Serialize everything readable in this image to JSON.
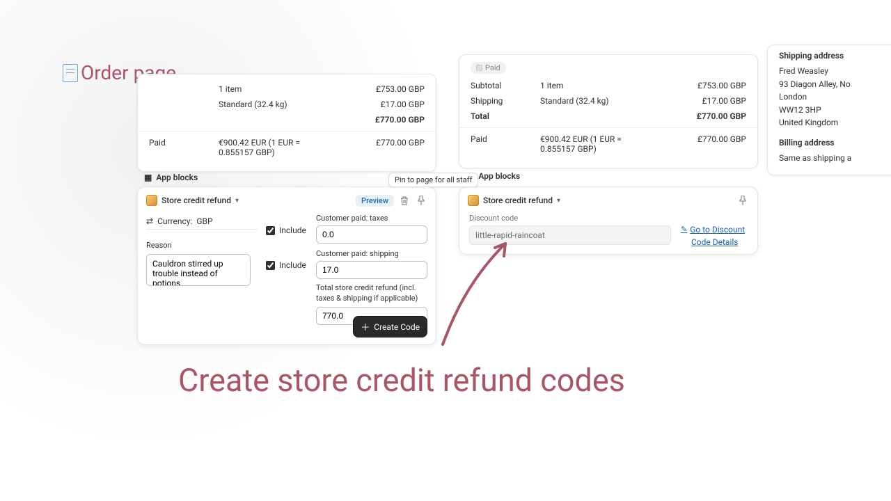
{
  "title": "Order page",
  "caption": "Create store credit refund codes",
  "order_left": {
    "items_label": "1 item",
    "subtotal_price": "£753.00 GBP",
    "shipping_label": "Standard (32.4 kg)",
    "shipping_price": "£17.00 GBP",
    "total_price": "£770.00 GBP",
    "paid_label": "Paid",
    "paid_left_conv": "€900.42 EUR (1 EUR = 0.855157 GBP)",
    "paid_right": "£770.00 GBP"
  },
  "order_right": {
    "paid_badge": "Paid",
    "subtotal_label": "Subtotal",
    "items_label": "1 item",
    "subtotal_price": "£753.00 GBP",
    "shipping_label": "Shipping",
    "shipping_method": "Standard (32.4 kg)",
    "shipping_price": "£17.00 GBP",
    "total_label": "Total",
    "total_price": "£770.00 GBP",
    "paid_label": "Paid",
    "paid_left_conv": "€900.42 EUR (1 EUR = 0.855157 GBP)",
    "paid_right": "£770.00 GBP"
  },
  "address": {
    "shipping_heading": "Shipping address",
    "name": "Fred Weasley",
    "line1": "93 Diagon Alley, No",
    "city": "London",
    "postcode": "WW12 3HP",
    "country": "United Kingdom",
    "billing_heading": "Billing address",
    "billing_same": "Same as shipping a"
  },
  "app_blocks_label": "App blocks",
  "app_left": {
    "name": "Store credit refund",
    "preview": "Preview",
    "pin_tooltip": "Pin to page for all staff",
    "currency_label": "Currency:",
    "currency_value": "GBP",
    "reason_label": "Reason",
    "reason_value": "Cauldron stirred up trouble instead of potions.",
    "include_label": "Include",
    "taxes_label": "Customer paid: taxes",
    "taxes_value": "0.0",
    "shipping_label": "Customer paid: shipping",
    "shipping_value": "17.0",
    "total_label": "Total store credit refund (incl. taxes & shipping if applicable)",
    "total_value": "770.0",
    "create_label": "Create Code"
  },
  "app_right": {
    "name": "Store credit refund",
    "discount_label": "Discount code",
    "discount_value": "little-rapid-raincoat",
    "link_line1": "Go to Discount",
    "link_line2": "Code Details"
  }
}
